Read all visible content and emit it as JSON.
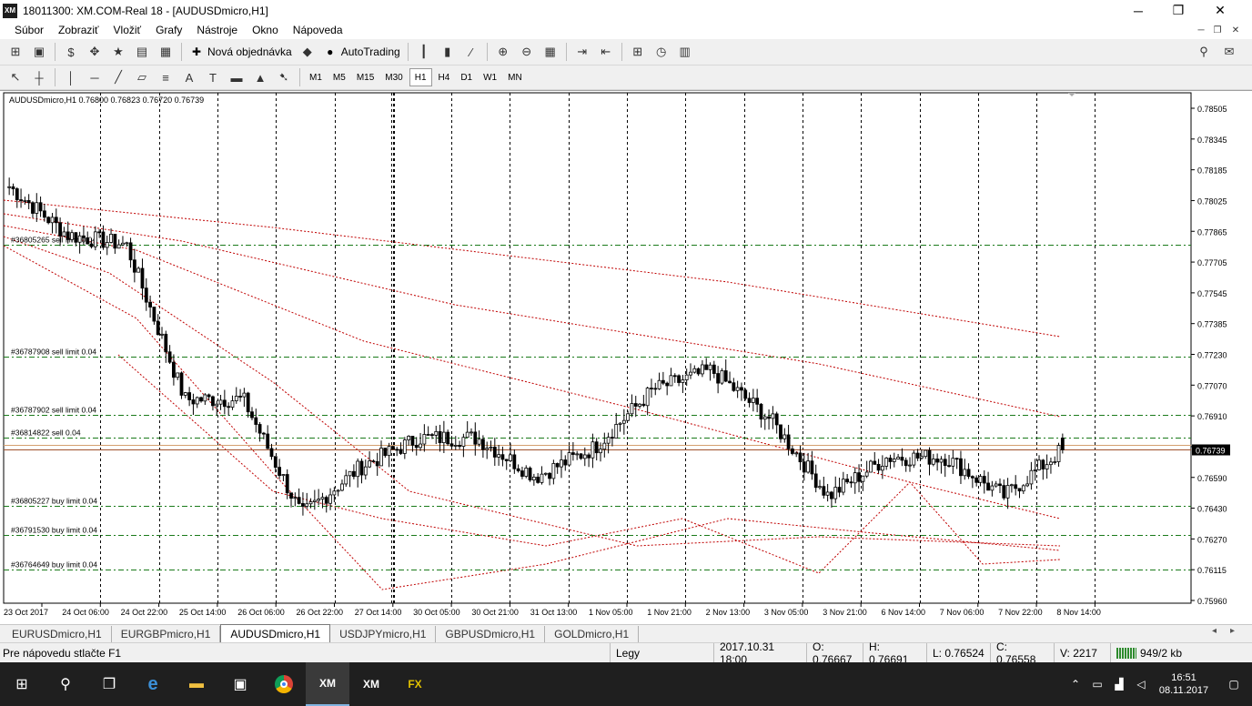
{
  "window": {
    "logo": "XM",
    "title": "18011300: XM.COM-Real 18 - [AUDUSDmicro,H1]",
    "minimize": "─",
    "maximize": "❐",
    "close": "✕"
  },
  "menu": [
    "Súbor",
    "Zobraziť",
    "Vložiť",
    "Grafy",
    "Nástroje",
    "Okno",
    "Nápoveda"
  ],
  "toolbar": {
    "new_order": "Nová objednávka",
    "autotrading": "AutoTrading"
  },
  "timeframes": [
    "M1",
    "M5",
    "M15",
    "M30",
    "H1",
    "H4",
    "D1",
    "W1",
    "MN"
  ],
  "active_timeframe": "H1",
  "chart": {
    "header": "AUDUSDmicro,H1  0.76800 0.76823 0.76720 0.76739",
    "current_price_label": "0.76739",
    "price_ticks": [
      "0.78505",
      "0.78345",
      "0.78185",
      "0.78025",
      "0.77865",
      "0.77705",
      "0.77545",
      "0.77385",
      "0.77230",
      "0.77070",
      "0.76910",
      "0.76750",
      "0.76590",
      "0.76430",
      "0.76270",
      "0.76115",
      "0.75960"
    ],
    "time_ticks": [
      "23 Oct 2017",
      "24 Oct 06:00",
      "24 Oct 22:00",
      "25 Oct 14:00",
      "26 Oct 06:00",
      "26 Oct 22:00",
      "27 Oct 14:00",
      "30 Oct 05:00",
      "30 Oct 21:00",
      "31 Oct 13:00",
      "1 Nov 05:00",
      "1 Nov 21:00",
      "2 Nov 13:00",
      "3 Nov 05:00",
      "3 Nov 21:00",
      "6 Nov 14:00",
      "7 Nov 06:00",
      "7 Nov 22:00",
      "8 Nov 14:00"
    ],
    "orders": [
      {
        "label": "#36805265 sell limit 0.04",
        "price": 0.778
      },
      {
        "label": "#36787908 sell limit 0.04",
        "price": 0.7722
      },
      {
        "label": "#36787902 sell limit 0.04",
        "price": 0.7692
      },
      {
        "label": "#36814822 sell 0.04",
        "price": 0.768
      },
      {
        "label": "#36805227 buy limit 0.04",
        "price": 0.7645
      },
      {
        "label": "#36791530 buy limit 0.04",
        "price": 0.763
      },
      {
        "label": "#36764649 buy limit 0.04",
        "price": 0.7612
      }
    ],
    "colors": {
      "bull": "#000000",
      "bear": "#000000",
      "ma": "#c00000",
      "order_line": "#1a7a1a",
      "bid_line": "#a0522d",
      "grid": "#000000"
    }
  },
  "chart_data": {
    "type": "line",
    "title": "AUDUSDmicro,H1",
    "xlabel": "",
    "ylabel": "",
    "ylim": [
      0.7596,
      0.78505
    ],
    "grid": true,
    "x": [
      "23 Oct 2017",
      "24 Oct 06:00",
      "24 Oct 22:00",
      "25 Oct 14:00",
      "26 Oct 06:00",
      "26 Oct 22:00",
      "27 Oct 14:00",
      "30 Oct 05:00",
      "30 Oct 21:00",
      "31 Oct 13:00",
      "1 Nov 05:00",
      "1 Nov 21:00",
      "2 Nov 13:00",
      "3 Nov 05:00",
      "3 Nov 21:00",
      "6 Nov 14:00",
      "7 Nov 06:00",
      "7 Nov 22:00",
      "8 Nov 14:00"
    ],
    "series": [
      {
        "name": "AUDUSDmicro,H1",
        "values": [
          0.781,
          0.7785,
          0.778,
          0.77,
          0.77,
          0.764,
          0.7665,
          0.768,
          0.768,
          0.766,
          0.7675,
          0.7705,
          0.7715,
          0.769,
          0.765,
          0.767,
          0.767,
          0.765,
          0.7674
        ]
      }
    ],
    "ohlc_last": {
      "open": 0.768,
      "high": 0.76823,
      "low": 0.7672,
      "close": 0.76739
    }
  },
  "tabs": [
    "EURUSDmicro,H1",
    "EURGBPmicro,H1",
    "AUDUSDmicro,H1",
    "USDJPYmicro,H1",
    "GBPUSDmicro,H1",
    "GOLDmicro,H1"
  ],
  "active_tab": "AUDUSDmicro,H1",
  "status": {
    "help": "Pre nápovedu stlačte F1",
    "profile": "Legy",
    "datetime": "2017.10.31 18:00",
    "open": "O: 0.76667",
    "high": "H: 0.76691",
    "low": "L: 0.76524",
    "close": "C: 0.76558",
    "volume": "V: 2217",
    "traffic": "949/2 kb"
  },
  "taskbar": {
    "time": "16:51",
    "date": "08.11.2017",
    "apps": [
      "XM",
      "XM",
      "FX"
    ]
  }
}
